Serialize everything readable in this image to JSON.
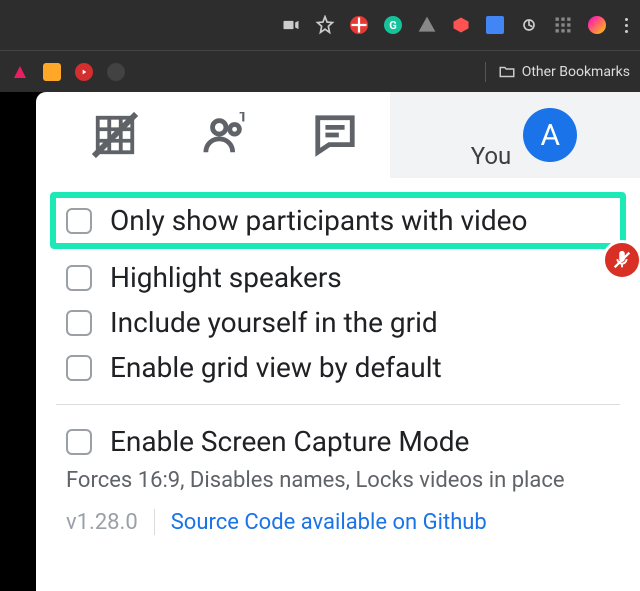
{
  "chrome": {
    "other_bookmarks": "Other Bookmarks"
  },
  "tabs": {
    "you_label": "You",
    "avatar_initial": "A"
  },
  "options": {
    "only_show_video": "Only show participants with video",
    "highlight_speakers": "Highlight speakers",
    "include_yourself": "Include yourself in the grid",
    "enable_default": "Enable grid view by default",
    "enable_screen_capture": "Enable Screen Capture Mode",
    "screen_capture_desc": "Forces 16:9, Disables names, Locks videos in place"
  },
  "footer": {
    "version": "v1.28.0",
    "github_link": "Source Code available on Github"
  }
}
